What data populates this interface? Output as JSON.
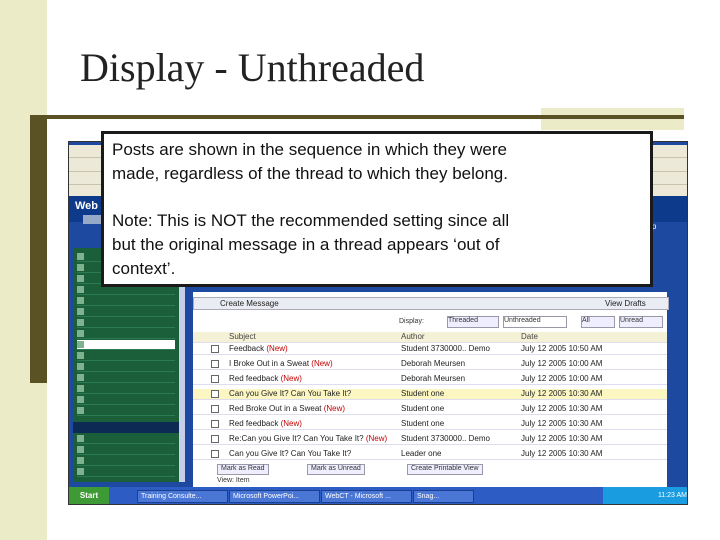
{
  "slide": {
    "title": "Display - Unthreaded",
    "callout_lines": [
      "Posts are shown in the sequence in which they were",
      "made, regardless of the thread to which they belong.",
      "Note:  This is NOT the recommended setting since all",
      "but the original message in a thread appears ‘out of",
      "context’."
    ]
  },
  "screenshot": {
    "logo": "Web",
    "right_text": "ne Up",
    "toolbar": {
      "create_message": "Create Message",
      "view_drafts": "View Drafts",
      "display_label": "Display:",
      "threaded": "Threaded",
      "unthreaded": "Unthreaded",
      "all": "All",
      "unread": "Unread"
    },
    "columns": [
      "Subject",
      "Author",
      "Date"
    ],
    "rows": [
      {
        "subject": "Feedback",
        "new": "(New)",
        "author": "Student 3730000.. Demo",
        "date": "July 12 2005 10:50 AM"
      },
      {
        "subject": "I Broke Out in a Sweat",
        "new": "(New)",
        "author": "Deborah Meursen",
        "date": "July 12 2005 10:00 AM"
      },
      {
        "subject": "Red feedback",
        "new": "(New)",
        "author": "Deborah Meursen",
        "date": "July 12 2005 10:00 AM"
      },
      {
        "subject": "Can you Give It? Can You Take It?",
        "new": "",
        "author": "Student one",
        "date": "July 12 2005 10:30 AM"
      },
      {
        "subject": "Red Broke Out in a Sweat",
        "new": "(New)",
        "author": "Student one",
        "date": "July 12 2005 10:30 AM"
      },
      {
        "subject": "Red feedback",
        "new": "(New)",
        "author": "Student one",
        "date": "July 12 2005 10:30 AM"
      },
      {
        "subject": "Re:Can you Give It? Can You Take It?",
        "new": "(New)",
        "author": "Student 3730000.. Demo",
        "date": "July 12 2005 10:30 AM"
      },
      {
        "subject": "Can you Give It? Can You Take It?",
        "new": "",
        "author": "Leader one",
        "date": "July 12 2005 10:30 AM"
      }
    ],
    "bottom_buttons": [
      "Mark as Read",
      "Mark as Unread",
      "Create Printable View"
    ],
    "bottom_view": "View:  Item",
    "taskbar": {
      "start": "Start",
      "items": [
        "Training Consulte...",
        "Microsoft PowerPoi...",
        "WebCT - Microsoft ...",
        "Snag..."
      ],
      "clock": "11:23 AM"
    }
  }
}
